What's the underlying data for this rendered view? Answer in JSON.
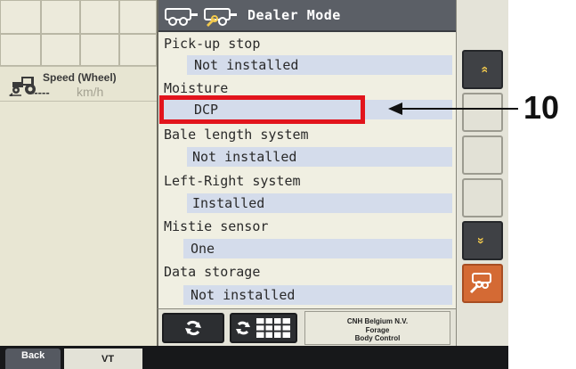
{
  "speed": {
    "label": "Speed (Wheel)",
    "value": "-----",
    "unit": "km/h"
  },
  "header": {
    "title": "Dealer Mode"
  },
  "params": [
    {
      "label": "Pick-up stop",
      "value": "Not installed"
    },
    {
      "label": "Moisture",
      "value": "DCP"
    },
    {
      "label": "Bale length system",
      "value": "Not installed"
    },
    {
      "label": "Left-Right system",
      "value": "Installed"
    },
    {
      "label": "Mistie sensor",
      "value": "One"
    },
    {
      "label": "Data storage",
      "value": "Not installed"
    }
  ],
  "right_buttons": [
    {
      "icon": "scroll-up-icon",
      "glyph": "»"
    },
    {
      "icon": "blank-softkey",
      "glyph": ""
    },
    {
      "icon": "blank-softkey",
      "glyph": ""
    },
    {
      "icon": "blank-softkey",
      "glyph": ""
    },
    {
      "icon": "scroll-down-icon",
      "glyph": "»"
    },
    {
      "icon": "settings-icon",
      "glyph": ""
    }
  ],
  "company": {
    "line1": "CNH Belgium N.V.",
    "line2": "Forage",
    "line3": "Body Control"
  },
  "tabs": {
    "back": "Back",
    "vt": "VT"
  },
  "annotation": {
    "callout": "10"
  },
  "colors": {
    "highlight": "#e2141c",
    "value_bg": "#d4dceb",
    "accent_orange": "#d46a34"
  }
}
